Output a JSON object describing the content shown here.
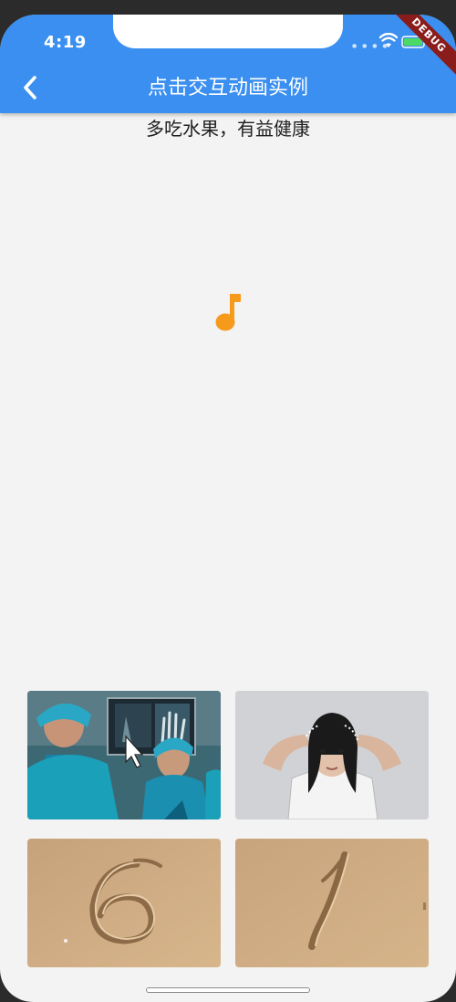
{
  "status_bar": {
    "time": "4:19",
    "debug_label": "DEBUG"
  },
  "app_bar": {
    "title": "点击交互动画实例",
    "back_icon": "chevron-left-icon"
  },
  "content": {
    "subtitle": "多吃水果，有益健康",
    "center_icon": "music-note-icon"
  },
  "colors": {
    "app_bar": "#3a8ff0",
    "background": "#f3f3f3",
    "music_note": "#f59a1b",
    "debug_ribbon": "#8b1c1c"
  },
  "images": [
    {
      "subject": "doctors-xray"
    },
    {
      "subject": "woman-hands-on-head"
    },
    {
      "subject": "sand-number-6"
    },
    {
      "subject": "sand-number-1"
    }
  ]
}
